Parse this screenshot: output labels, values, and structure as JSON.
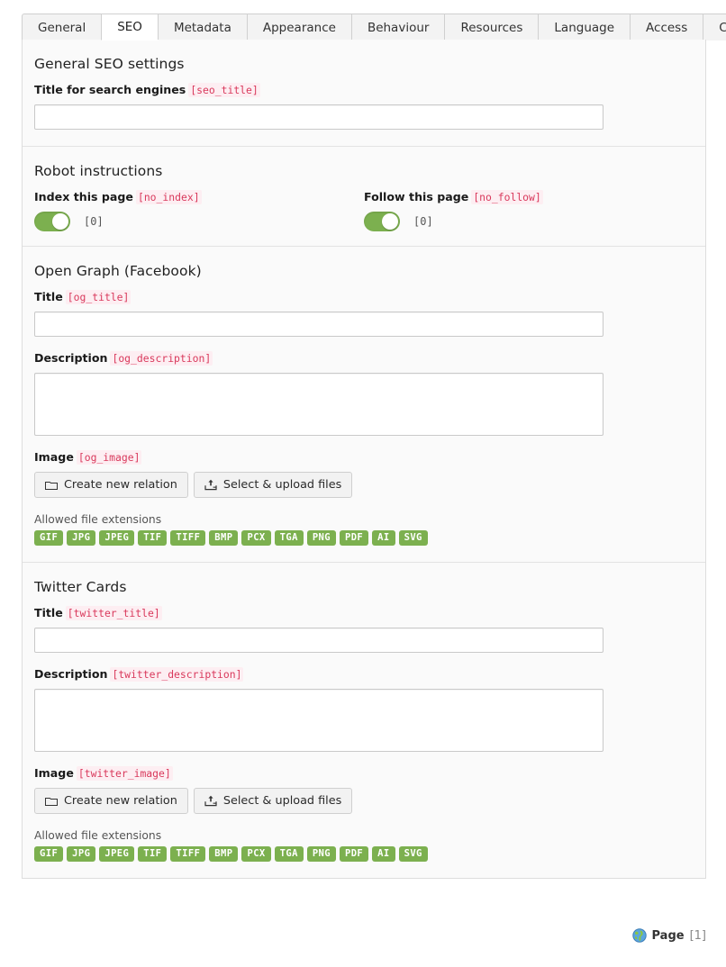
{
  "tabs": [
    {
      "label": "General",
      "active": false
    },
    {
      "label": "SEO",
      "active": true
    },
    {
      "label": "Metadata",
      "active": false
    },
    {
      "label": "Appearance",
      "active": false
    },
    {
      "label": "Behaviour",
      "active": false
    },
    {
      "label": "Resources",
      "active": false
    },
    {
      "label": "Language",
      "active": false
    },
    {
      "label": "Access",
      "active": false
    },
    {
      "label": "Categories",
      "active": false
    }
  ],
  "colors": {
    "accent_green": "#7cb04f",
    "code_red": "#d9395c",
    "code_bg": "#fdeef2",
    "panel_bg": "#fafafa",
    "border": "#dddddd"
  },
  "sections": {
    "general_seo": {
      "title": "General SEO settings",
      "seo_title": {
        "label": "Title for search engines",
        "code": "[seo_title]",
        "value": "",
        "placeholder": ""
      }
    },
    "robot": {
      "title": "Robot instructions",
      "index": {
        "label": "Index this page",
        "code": "[no_index]",
        "state": "on",
        "value": "[0]"
      },
      "follow": {
        "label": "Follow this page",
        "code": "[no_follow]",
        "state": "on",
        "value": "[0]"
      }
    },
    "open_graph": {
      "title": "Open Graph (Facebook)",
      "og_title": {
        "label": "Title",
        "code": "[og_title]",
        "value": "",
        "placeholder": ""
      },
      "og_description": {
        "label": "Description",
        "code": "[og_description]",
        "value": "",
        "placeholder": ""
      },
      "og_image": {
        "label": "Image",
        "code": "[og_image]",
        "create_button": "Create new relation",
        "upload_button": "Select & upload files",
        "extensions_caption": "Allowed file extensions",
        "extensions": [
          "GIF",
          "JPG",
          "JPEG",
          "TIF",
          "TIFF",
          "BMP",
          "PCX",
          "TGA",
          "PNG",
          "PDF",
          "AI",
          "SVG"
        ]
      }
    },
    "twitter": {
      "title": "Twitter Cards",
      "twitter_title": {
        "label": "Title",
        "code": "[twitter_title]",
        "value": "",
        "placeholder": ""
      },
      "twitter_description": {
        "label": "Description",
        "code": "[twitter_description]",
        "value": "",
        "placeholder": ""
      },
      "twitter_image": {
        "label": "Image",
        "code": "[twitter_image]",
        "create_button": "Create new relation",
        "upload_button": "Select & upload files",
        "extensions_caption": "Allowed file extensions",
        "extensions": [
          "GIF",
          "JPG",
          "JPEG",
          "TIF",
          "TIFF",
          "BMP",
          "PCX",
          "TGA",
          "PNG",
          "PDF",
          "AI",
          "SVG"
        ]
      }
    }
  },
  "footer": {
    "icon": "globe-icon",
    "label": "Page",
    "count": "[1]"
  }
}
